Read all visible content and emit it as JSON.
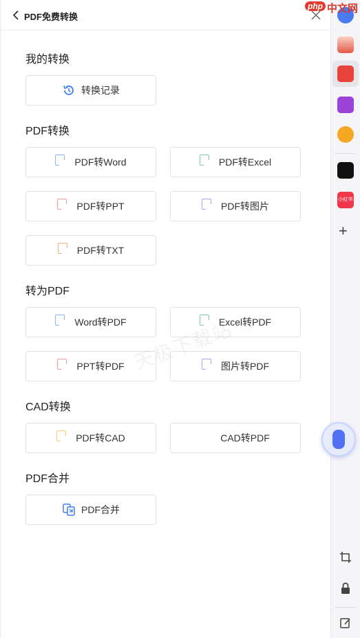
{
  "header": {
    "title": "PDF免费转换"
  },
  "watermark": "天极下载站",
  "sections": {
    "mine": {
      "title": "我的转换",
      "history": "转换记录"
    },
    "pdf_convert": {
      "title": "PDF转换",
      "to_word": "PDF转Word",
      "to_excel": "PDF转Excel",
      "to_ppt": "PDF转PPT",
      "to_image": "PDF转图片",
      "to_txt": "PDF转TXT"
    },
    "to_pdf": {
      "title": "转为PDF",
      "word": "Word转PDF",
      "excel": "Excel转PDF",
      "ppt": "PPT转PDF",
      "image": "图片转PDF"
    },
    "cad": {
      "title": "CAD转换",
      "pdf_to_cad": "PDF转CAD",
      "cad_to_pdf": "CAD转PDF"
    },
    "merge": {
      "title": "PDF合并",
      "merge": "PDF合并"
    }
  },
  "brand_badge": {
    "php": "php",
    "site": "中文网"
  },
  "rail": {
    "small_app_label": "小红书"
  }
}
